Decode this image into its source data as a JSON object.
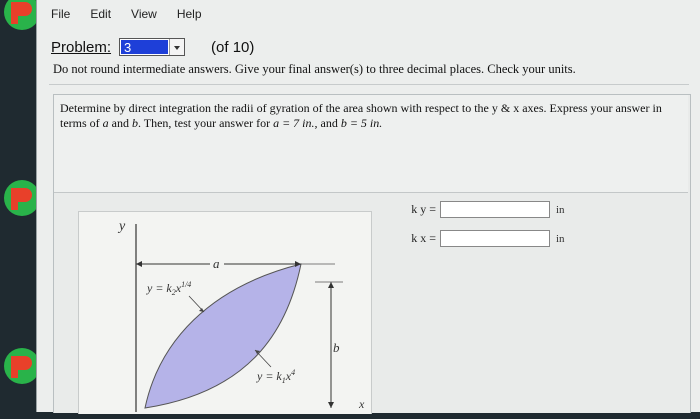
{
  "menu": {
    "file": "File",
    "edit": "Edit",
    "view": "View",
    "help": "Help"
  },
  "problem": {
    "label": "Problem:",
    "selected": "3",
    "of_total": "(of 10)"
  },
  "instructions": "Do not round intermediate answers.  Give your final answer(s) to three decimal places.  Check your units.",
  "question": {
    "line1": "Determine by direct integration the radii of gyration of the area shown with respect to the y & x axes. Express your answer in",
    "line2_prefix": "terms of ",
    "var_a": "a",
    "and": " and ",
    "var_b": "b",
    "line2_suffix": ".  Then, test your answer for ",
    "eq_a": "a = 7 in.,",
    "and2": " and ",
    "eq_b": "b = 5 in."
  },
  "figure": {
    "y_axis": "y",
    "x_axis": "x",
    "dim_a": "a",
    "dim_b": "b",
    "curve_upper_base": "y = k",
    "curve_upper_sub": "2",
    "curve_upper_var": "x",
    "curve_upper_exp": "1/4",
    "curve_lower_base": "y = k",
    "curve_lower_sub": "1",
    "curve_lower_var": "x",
    "curve_lower_exp": "4"
  },
  "answers": [
    {
      "label": "k y =",
      "value": "",
      "unit": "in"
    },
    {
      "label": "k x =",
      "value": "",
      "unit": "in"
    }
  ],
  "colors": {
    "fill": "#b5b3e8",
    "select_bg": "#1e3fd8",
    "icon_red": "#e8402a",
    "icon_green": "#29b34a"
  }
}
